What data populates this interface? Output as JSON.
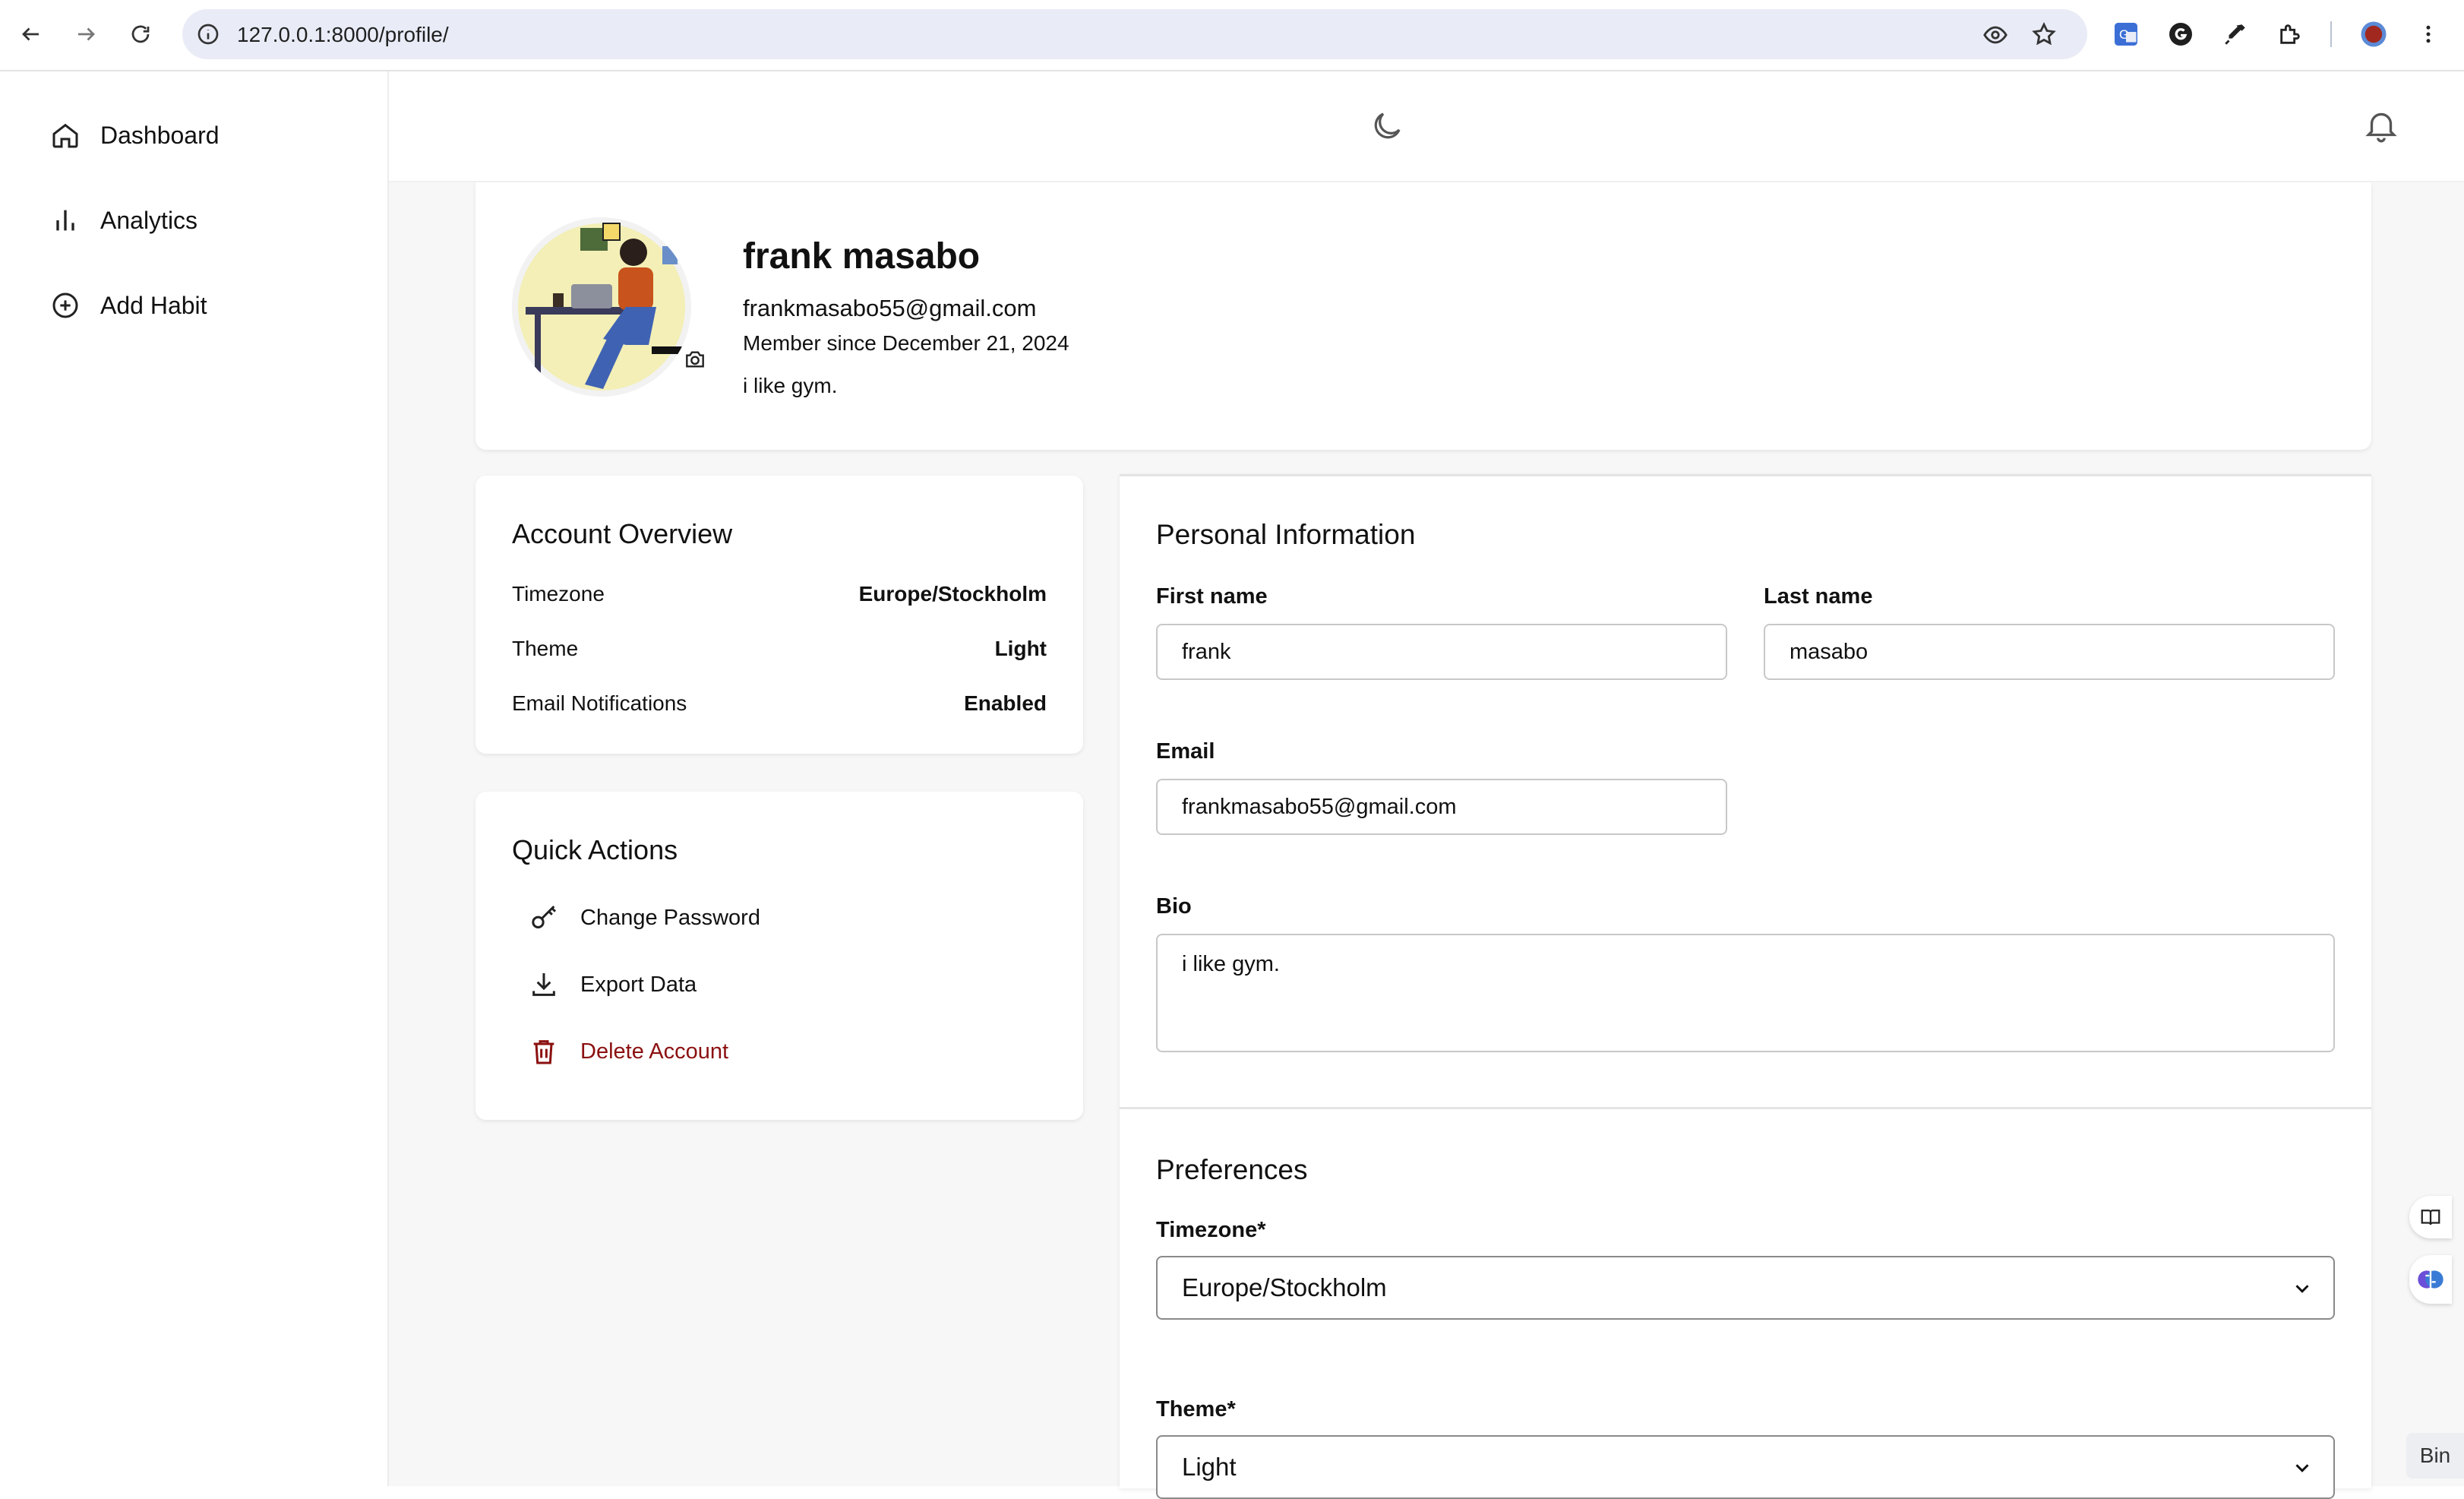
{
  "browser": {
    "url": "127.0.0.1:8000/profile/"
  },
  "sidebar": {
    "items": [
      {
        "label": "Dashboard",
        "icon": "home-icon"
      },
      {
        "label": "Analytics",
        "icon": "bar-chart-icon"
      },
      {
        "label": "Add Habit",
        "icon": "plus-circle-icon"
      }
    ]
  },
  "topbar": {
    "theme_icon": "moon-icon",
    "notifications_icon": "bell-icon"
  },
  "profile": {
    "name": "frank masabo",
    "email": "frankmasabo55@gmail.com",
    "member_since": "Member since December 21, 2024",
    "bio": "i like gym."
  },
  "overview": {
    "title": "Account Overview",
    "rows": [
      {
        "label": "Timezone",
        "value": "Europe/Stockholm"
      },
      {
        "label": "Theme",
        "value": "Light"
      },
      {
        "label": "Email Notifications",
        "value": "Enabled"
      }
    ]
  },
  "quick_actions": {
    "title": "Quick Actions",
    "items": [
      {
        "label": "Change Password",
        "icon": "key-icon"
      },
      {
        "label": "Export Data",
        "icon": "download-icon"
      },
      {
        "label": "Delete Account",
        "icon": "trash-icon"
      }
    ]
  },
  "personal_info": {
    "title": "Personal Information",
    "first_name_label": "First name",
    "first_name_value": "frank",
    "last_name_label": "Last name",
    "last_name_value": "masabo",
    "email_label": "Email",
    "email_value": "frankmasabo55@gmail.com",
    "bio_label": "Bio",
    "bio_value": "i like gym."
  },
  "preferences": {
    "title": "Preferences",
    "timezone_label": "Timezone*",
    "timezone_value": "Europe/Stockholm",
    "theme_label": "Theme*",
    "theme_value": "Light"
  },
  "edge_tab": {
    "label": "Bin"
  },
  "colors": {
    "danger": "#8b1010",
    "background": "#f7f7f8"
  }
}
